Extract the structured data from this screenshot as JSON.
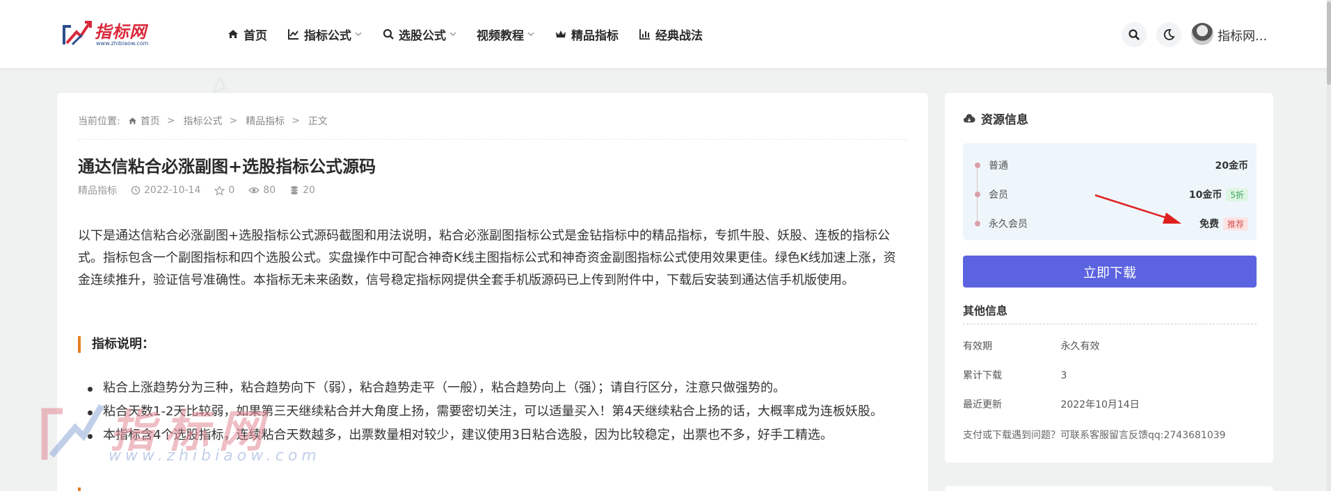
{
  "header": {
    "logo_name": "指标网",
    "logo_url": "www.zhibiaow.com",
    "nav": [
      {
        "label": "首页",
        "icon": "home-icon",
        "dropdown": false
      },
      {
        "label": "指标公式",
        "icon": "chart-line-icon",
        "dropdown": true
      },
      {
        "label": "选股公式",
        "icon": "search-icon",
        "dropdown": true
      },
      {
        "label": "视频教程",
        "icon": "",
        "dropdown": true
      },
      {
        "label": "精品指标",
        "icon": "crown-icon",
        "dropdown": false
      },
      {
        "label": "经典战法",
        "icon": "bar-chart-icon",
        "dropdown": false
      }
    ],
    "user_name": "指标网..."
  },
  "breadcrumb": {
    "prefix": "当前位置:",
    "items": [
      "首页",
      "指标公式",
      "精品指标",
      "正文"
    ],
    "separator": ">"
  },
  "article": {
    "title": "通达信粘合必涨副图+选股指标公式源码",
    "category": "精品指标",
    "date": "2022-10-14",
    "likes": "0",
    "views": "80",
    "coins": "20",
    "intro": "以下是通达信粘合必涨副图+选股指标公式源码截图和用法说明，粘合必涨副图指标公式是金钻指标中的精品指标，专抓牛股、妖股、连板的指标公式。指标包含一个副图指标和四个选股公式。实盘操作中可配合神奇K线主图指标公式和神奇资金副图指标公式使用效果更佳。绿色K线加速上涨，资金连续推升，验证信号准确性。本指标无未来函数，信号稳定指标网提供全套手机版源码已上传到附件中，下载后安装到通达信手机版使用。",
    "section_heading": "指标说明：",
    "bullets": [
      "粘合上涨趋势分为三种，粘合趋势向下（弱），粘合趋势走平（一般），粘合趋势向上（强）；请自行区分，注意只做强势的。",
      "粘合天数1-2天比较弱，如果第三天继续粘合并大角度上扬，需要密切关注，可以适量买入！第4天继续粘合上扬的话，大概率成为连板妖股。",
      "本指标含4个选股指标，连续粘合天数越多，出票数量相对较少，建议使用3日粘合选股，因为比较稳定，出票也不多，好手工精选。"
    ]
  },
  "sidebar": {
    "title": "资源信息",
    "prices": [
      {
        "label": "普通",
        "value": "20金币",
        "tag": "",
        "tag_color": ""
      },
      {
        "label": "会员",
        "value": "10金币",
        "tag": "5折",
        "tag_color": "green"
      },
      {
        "label": "永久会员",
        "value": "免费",
        "tag": "推荐",
        "tag_color": "red"
      }
    ],
    "download_label": "立即下载",
    "other_title": "其他信息",
    "info": [
      {
        "key": "有效期",
        "value": "永久有效"
      },
      {
        "key": "累计下载",
        "value": "3"
      },
      {
        "key": "最近更新",
        "value": "2022年10月14日"
      }
    ],
    "help": "支付或下载遇到问题？可联系客服留言反馈qq:2743681039"
  },
  "watermark": {
    "text": "指标网",
    "url": "www.zhibiaow.com"
  },
  "colors": {
    "accent": "#5c63e0",
    "section_bar": "#e67e22",
    "logo_red": "#d8283a"
  }
}
